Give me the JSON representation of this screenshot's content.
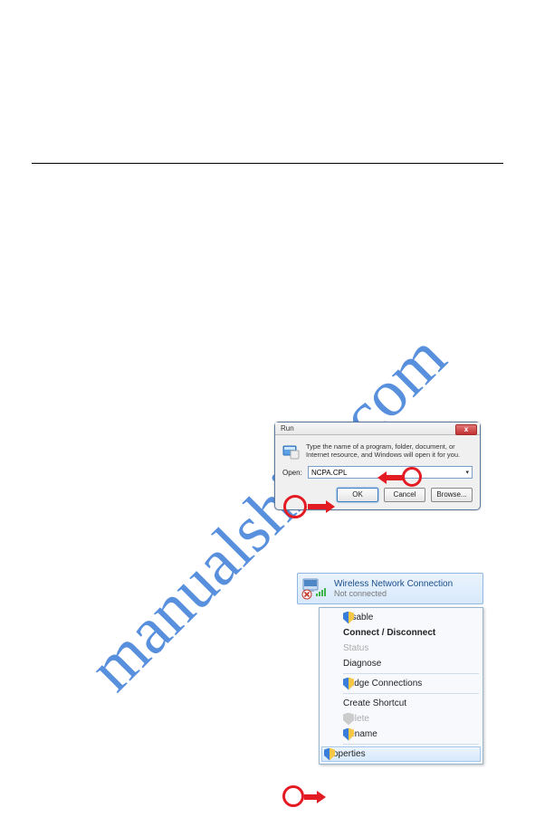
{
  "watermark": "manualshive.com",
  "run": {
    "title_icon": "run-icon",
    "title": "Run",
    "close_label": "x",
    "message": "Type the name of a program, folder, document, or Internet resource, and Windows will open it for you.",
    "open_label": "Open:",
    "open_value": "NCPA.CPL",
    "buttons": {
      "ok": "OK",
      "cancel": "Cancel",
      "browse": "Browse..."
    }
  },
  "wnc": {
    "title": "Wireless Network Connection",
    "status": "Not connected"
  },
  "context_menu": {
    "items": [
      {
        "label": "Disable",
        "icon": "shield",
        "disabled": false
      },
      {
        "label": "Connect / Disconnect",
        "icon": null,
        "bold": true
      },
      {
        "label": "Status",
        "icon": null,
        "disabled": true
      },
      {
        "label": "Diagnose",
        "icon": null
      },
      {
        "sep": true
      },
      {
        "label": "Bridge Connections",
        "icon": "shield"
      },
      {
        "sep": true
      },
      {
        "label": "Create Shortcut",
        "icon": null
      },
      {
        "label": "Delete",
        "icon": "shield-gray",
        "disabled": true
      },
      {
        "label": "Rename",
        "icon": "shield"
      },
      {
        "sep": true
      },
      {
        "label": "Properties",
        "icon": "shield",
        "hover": true
      }
    ]
  }
}
